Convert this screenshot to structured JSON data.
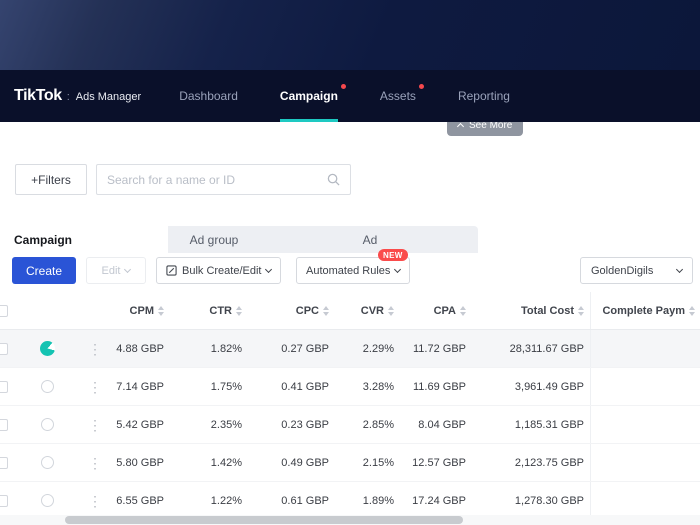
{
  "navbar": {
    "brand": "TikTok",
    "divider": ":",
    "product": "Ads Manager",
    "items": [
      {
        "label": "Dashboard",
        "active": false,
        "notification_dot": false
      },
      {
        "label": "Campaign",
        "active": true,
        "notification_dot": true
      },
      {
        "label": "Assets",
        "active": false,
        "notification_dot": true
      },
      {
        "label": "Reporting",
        "active": false,
        "notification_dot": false
      }
    ]
  },
  "see_more_label": "See More",
  "filter_bar": {
    "filters_button": "+Filters",
    "search_placeholder": "Search for a name or ID"
  },
  "tabs": {
    "campaign": "Campaign",
    "ad_group": "Ad group",
    "ad": "Ad"
  },
  "toolbar": {
    "create": "Create",
    "edit": "Edit",
    "bulk_create_edit": "Bulk Create/Edit",
    "automated_rules": "Automated Rules",
    "new_badge": "NEW",
    "account_selector": "GoldenDigils"
  },
  "icons": {
    "more_options": "⋮"
  },
  "table": {
    "columns": {
      "cpm": "CPM",
      "ctr": "CTR",
      "cpc": "CPC",
      "cvr": "CVR",
      "cpa": "CPA",
      "total_cost": "Total Cost",
      "complete_payment": "Complete Paym"
    },
    "rows": [
      {
        "status": "on",
        "highlighted": true,
        "cpm": "4.88 GBP",
        "ctr": "1.82%",
        "cpc": "0.27 GBP",
        "cvr": "2.29%",
        "cpa": "11.72 GBP",
        "total_cost": "28,311.67 GBP"
      },
      {
        "status": "off",
        "highlighted": false,
        "cpm": "7.14 GBP",
        "ctr": "1.75%",
        "cpc": "0.41 GBP",
        "cvr": "3.28%",
        "cpa": "11.69 GBP",
        "total_cost": "3,961.49 GBP"
      },
      {
        "status": "off",
        "highlighted": false,
        "cpm": "5.42 GBP",
        "ctr": "2.35%",
        "cpc": "0.23 GBP",
        "cvr": "2.85%",
        "cpa": "8.04 GBP",
        "total_cost": "1,185.31 GBP"
      },
      {
        "status": "off",
        "highlighted": false,
        "cpm": "5.80 GBP",
        "ctr": "1.42%",
        "cpc": "0.49 GBP",
        "cvr": "2.15%",
        "cpa": "12.57 GBP",
        "total_cost": "2,123.75 GBP"
      },
      {
        "status": "off",
        "highlighted": false,
        "cpm": "6.55 GBP",
        "ctr": "1.22%",
        "cpc": "0.61 GBP",
        "cvr": "1.89%",
        "cpa": "17.24 GBP",
        "total_cost": "1,278.30 GBP"
      }
    ]
  },
  "colors": {
    "navy_dark": "#0a102a",
    "accent_teal": "#1ec9c2",
    "primary_blue": "#2a54d6",
    "badge_red": "#fa4b4b"
  }
}
